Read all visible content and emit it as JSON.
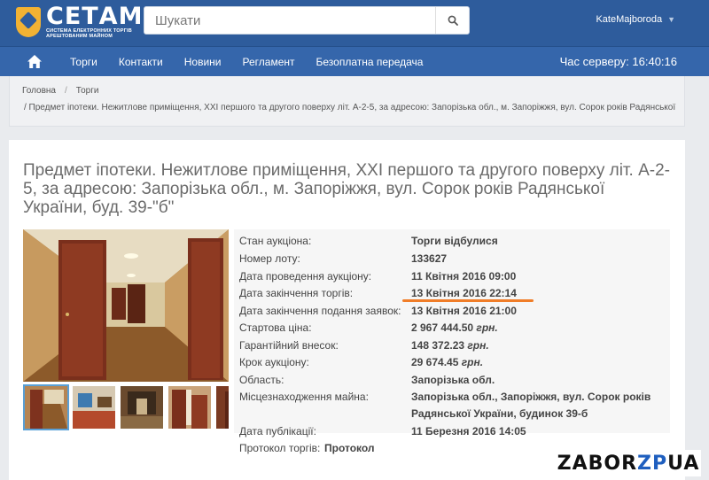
{
  "header": {
    "logo_title": "СЕТАМ",
    "logo_subtitle_1": "СИСТЕМА ЕЛЕКТРОННИХ ТОРГІВ",
    "logo_subtitle_2": "АРЕШТОВАНИМ МАЙНОМ",
    "search_placeholder": "Шукати",
    "user_name": "KateMajboroda"
  },
  "nav": {
    "items": [
      "Торги",
      "Контакти",
      "Новини",
      "Регламент",
      "Безоплатна передача"
    ],
    "server_time": "Час серверу: 16:40:16"
  },
  "breadcrumb": {
    "items": [
      "Головна",
      "Торги"
    ],
    "current": "/   Предмет іпотеки. Нежитлове приміщення, XXI першого та другого поверху літ. А-2-5, за адресою: Запорізька обл., м. Запоріжжя, вул. Сорок років Радянської"
  },
  "lot": {
    "title": "Предмет іпотеки. Нежитлове приміщення, XXI першого та другого поверху літ. А-2-5, за адресою: Запорізька обл., м. Запоріжжя, вул. Сорок років Радянської України, буд. 39-\"б\"",
    "details": [
      {
        "label": "Стан аукціона:",
        "value": "Торги відбулися"
      },
      {
        "label": "Номер лоту:",
        "value": "133627"
      },
      {
        "label": "Дата проведення аукціону:",
        "value": "11 Квітня 2016 09:00"
      },
      {
        "label": "Дата закінчення торгів:",
        "value": "13 Квітня 2016 22:14"
      },
      {
        "label": "Дата закінчення подання заявок:",
        "value": "13 Квітня 2016 21:00"
      },
      {
        "label": "Стартова ціна:",
        "value": "2 967 444.50",
        "unit": "грн."
      },
      {
        "label": "Гарантійний внесок:",
        "value": "148 372.23",
        "unit": "грн."
      },
      {
        "label": "Крок аукціону:",
        "value": "29 674.45",
        "unit": "грн."
      },
      {
        "label": "Область:",
        "value": "Запорізька обл."
      },
      {
        "label": "Місцезнаходження майна:",
        "value": "Запорізька обл., Запоріжжя, вул. Сорок років",
        "value2": "Радянської України, будинок 39-б"
      },
      {
        "label": "Дата публікації:",
        "value": "11 Березня 2016 14:05"
      },
      {
        "label": "Протокол торгів:",
        "value": "Протокол"
      }
    ]
  },
  "watermark": {
    "part1": "ZABOR",
    "part2": "ZP",
    "part3": "UA"
  },
  "colors": {
    "header_bg": "#2e5c9c",
    "nav_bg": "#3566ab",
    "logo_gold": "#f2b233",
    "highlight_orange": "#f07d28",
    "link_blue": "#2a5aa0"
  }
}
